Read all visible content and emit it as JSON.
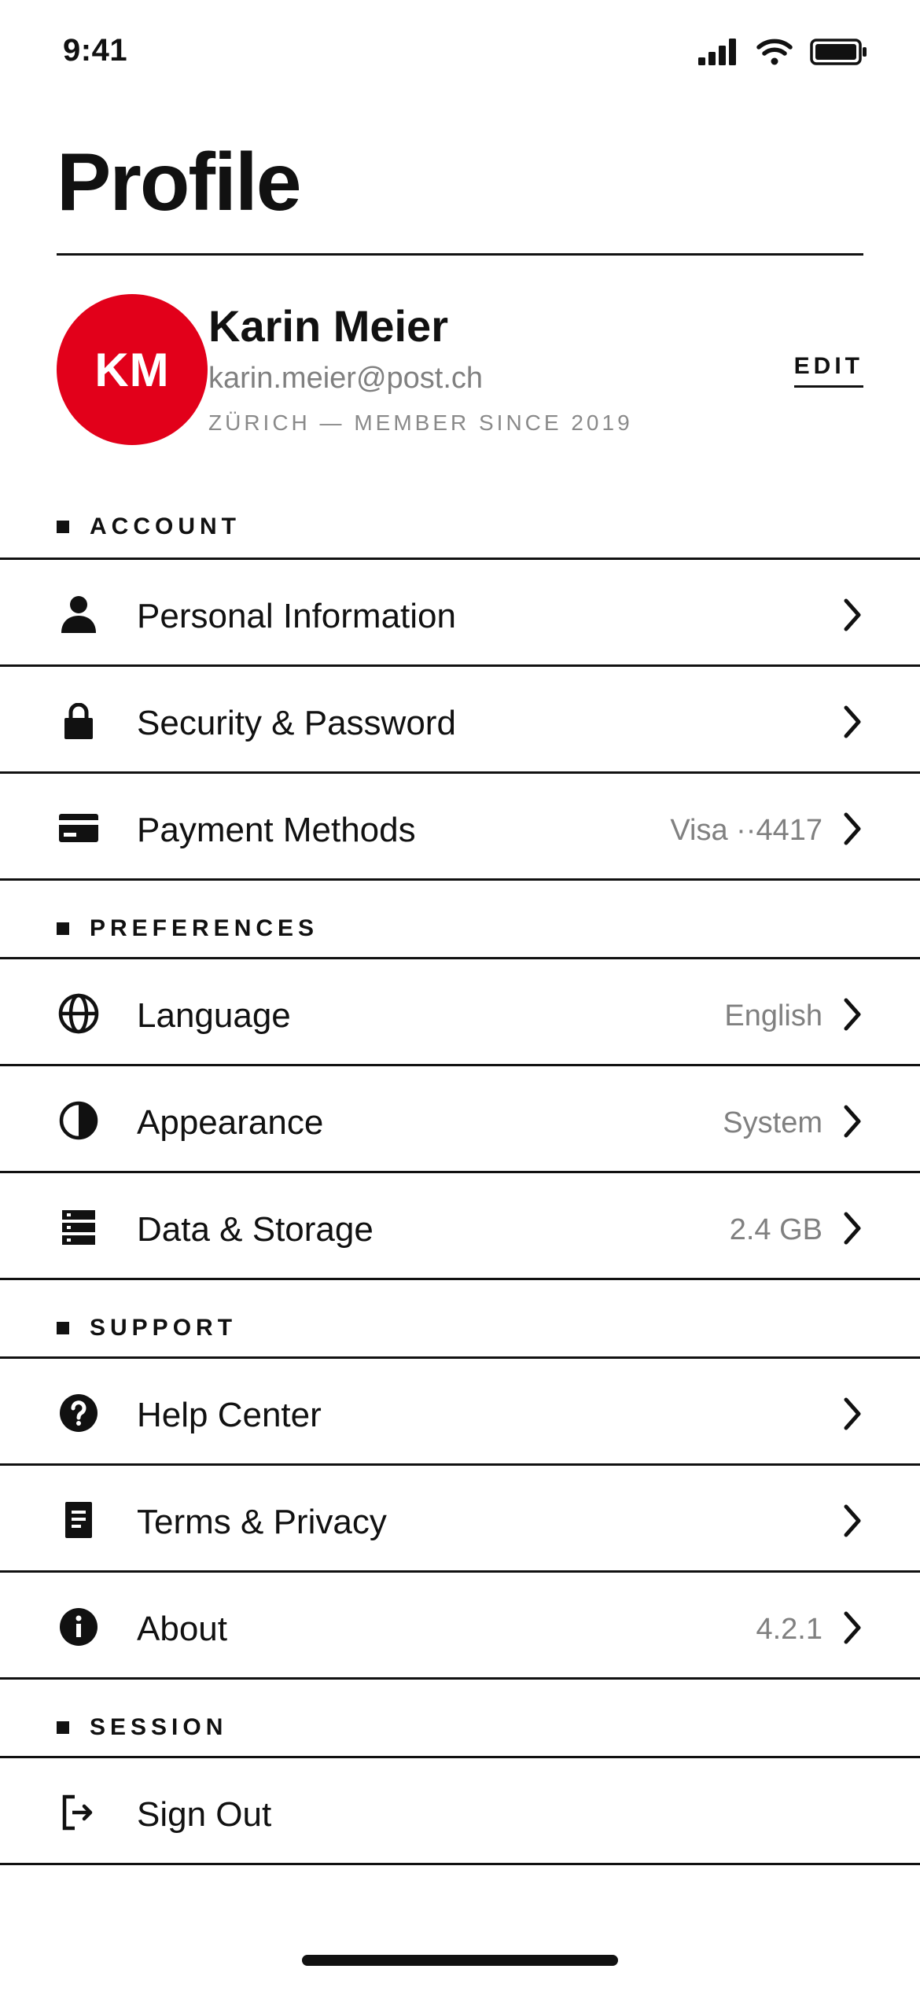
{
  "status_bar": {
    "time": "9:41",
    "icons": [
      "cellular-signal-icon",
      "wifi-icon",
      "battery-icon"
    ]
  },
  "page": {
    "title": "Profile"
  },
  "profile": {
    "initials": "KM",
    "name": "Karin Meier",
    "email": "karin.meier@post.ch",
    "meta": "ZÜRICH — MEMBER SINCE 2019",
    "edit_label": "EDIT",
    "avatar_color": "#e2001a"
  },
  "sections": {
    "account": {
      "title": "ACCOUNT",
      "items": [
        {
          "label": "Personal Information",
          "value": "",
          "icon": "person-icon"
        },
        {
          "label": "Security & Password",
          "value": "",
          "icon": "lock-icon"
        },
        {
          "label": "Payment Methods",
          "value": "Visa ··4417",
          "icon": "credit-card-icon"
        }
      ]
    },
    "preferences": {
      "title": "PREFERENCES",
      "items": [
        {
          "label": "Language",
          "value": "English",
          "icon": "globe-icon"
        },
        {
          "label": "Appearance",
          "value": "System",
          "icon": "contrast-icon"
        },
        {
          "label": "Data & Storage",
          "value": "2.4 GB",
          "icon": "storage-icon"
        }
      ]
    },
    "support": {
      "title": "SUPPORT",
      "items": [
        {
          "label": "Help Center",
          "value": "",
          "icon": "help-icon"
        },
        {
          "label": "Terms & Privacy",
          "value": "",
          "icon": "document-icon"
        },
        {
          "label": "About",
          "value": "4.2.1",
          "icon": "info-icon"
        }
      ]
    },
    "session": {
      "title": "SESSION",
      "items": [
        {
          "label": "Sign Out",
          "value": "",
          "icon": "sign-out-icon"
        }
      ]
    }
  },
  "colors": {
    "accent": "#e2001a",
    "text": "#111111",
    "secondary_text": "#808080",
    "background": "#ffffff"
  }
}
